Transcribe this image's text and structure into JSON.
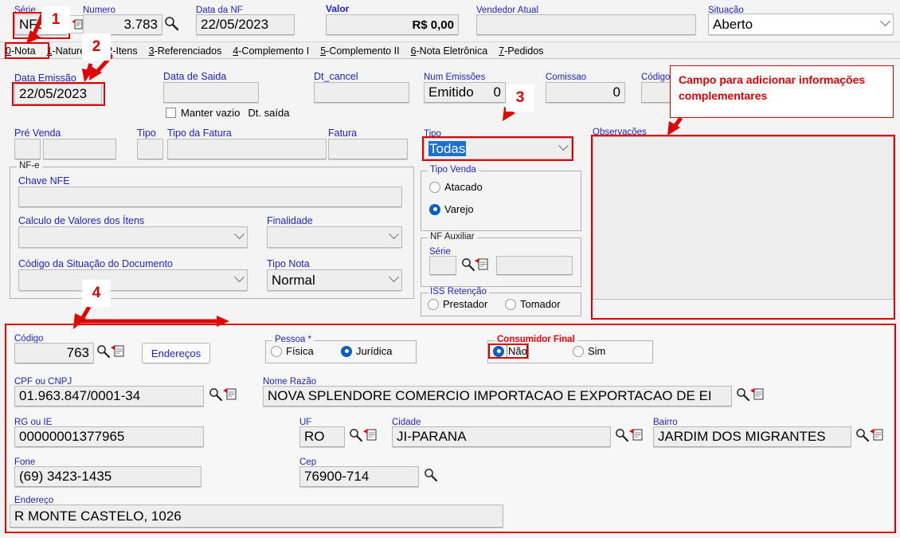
{
  "header": {
    "serie": {
      "label": "Série",
      "value": "NFE"
    },
    "numero": {
      "label": "Numero",
      "value": "3.783"
    },
    "data_nf": {
      "label": "Data da NF",
      "value": "22/05/2023"
    },
    "valor": {
      "label": "Valor",
      "value": "R$ 0,00"
    },
    "vendedor": {
      "label": "Vendedor Atual",
      "value": ""
    },
    "situacao": {
      "label": "Situação",
      "value": "Aberto"
    }
  },
  "tabs": [
    {
      "key": "0",
      "label": "0-Nota",
      "active": true
    },
    {
      "key": "1",
      "label": "1-Natureza",
      "active": false
    },
    {
      "key": "2",
      "label": "2-Itens",
      "active": false
    },
    {
      "key": "3",
      "label": "3-Referenciados",
      "active": false
    },
    {
      "key": "4",
      "label": "4-Complemento I",
      "active": false
    },
    {
      "key": "5",
      "label": "5-Complemento II",
      "active": false
    },
    {
      "key": "6",
      "label": "6-Nota Eletrônica",
      "active": false
    },
    {
      "key": "7",
      "label": "7-Pedidos",
      "active": false
    }
  ],
  "nota": {
    "data_emissao": {
      "label": "Data Emissão",
      "value": "22/05/2023"
    },
    "data_saida": {
      "label": "Data de Saida",
      "value": ""
    },
    "manter_vazio": {
      "label": "Manter vazio",
      "label2": "Dt. saída",
      "checked": false
    },
    "dt_cancel": {
      "label": "Dt_cancel",
      "value": ""
    },
    "num_emissoes": {
      "label": "Num Emissões",
      "value": "Emitido",
      "value2": "0"
    },
    "comissao": {
      "label": "Comissao",
      "value": "0"
    },
    "codigo_top": {
      "label": "Código",
      "value": ""
    },
    "pre_venda": {
      "label": "Pré Venda",
      "value": "",
      "value2": ""
    },
    "tipo_small": {
      "label": "Tipo",
      "value": ""
    },
    "tipo_fatura": {
      "label": "Tipo da Fatura",
      "value": ""
    },
    "fatura": {
      "label": "Fatura",
      "value": ""
    },
    "tipo": {
      "label": "Tipo",
      "value": "Todas"
    },
    "observacoes": {
      "label": "Observações",
      "value": ""
    }
  },
  "nfe": {
    "group_title": "NF-e",
    "chave_nfe": {
      "label": "Chave NFE",
      "value": ""
    },
    "calculo_valores": {
      "label": "Calculo de Valores dos Ítens",
      "value": ""
    },
    "finalidade": {
      "label": "Finalidade",
      "value": ""
    },
    "cod_situacao": {
      "label": "Código da Situação do Documento",
      "value": ""
    },
    "tipo_nota": {
      "label": "Tipo Nota",
      "value": "Normal"
    }
  },
  "tipo_venda": {
    "group_title": "Tipo Venda",
    "options": [
      {
        "label": "Atacado",
        "selected": false
      },
      {
        "label": "Varejo",
        "selected": true
      }
    ]
  },
  "nf_auxiliar": {
    "group_title": "NF Auxiliar",
    "serie": {
      "label": "Série",
      "value": ""
    },
    "numero": {
      "value": ""
    }
  },
  "iss_retencao": {
    "group_title": "ISS Retenção",
    "options": [
      {
        "label": "Prestador",
        "selected": false
      },
      {
        "label": "Tomador",
        "selected": false
      }
    ]
  },
  "cliente": {
    "codigo": {
      "label": "Código",
      "value": "763"
    },
    "enderecos_button": "Endereços",
    "pessoa": {
      "group_title": "Pessoa *",
      "options": [
        {
          "label": "Física",
          "selected": false
        },
        {
          "label": "Jurídica",
          "selected": true
        }
      ]
    },
    "consumidor_final": {
      "group_title": "Consumidor Final",
      "options": [
        {
          "label": "Não",
          "selected": true,
          "focused": true
        },
        {
          "label": "Sim",
          "selected": false
        }
      ]
    },
    "cpf_cnpj": {
      "label": "CPF ou CNPJ",
      "value": "01.963.847/0001-34"
    },
    "nome_razao": {
      "label": "Nome Razão",
      "value": "NOVA SPLENDORE COMERCIO IMPORTACAO E EXPORTACAO DE EI"
    },
    "rg_ie": {
      "label": "RG ou IE",
      "value": "00000001377965"
    },
    "uf": {
      "label": "UF",
      "value": "RO"
    },
    "cidade": {
      "label": "Cidade",
      "value": "JI-PARANA"
    },
    "bairro": {
      "label": "Bairro",
      "value": "JARDIM DOS MIGRANTES"
    },
    "fone": {
      "label": "Fone",
      "value": "(69) 3423-1435"
    },
    "cep": {
      "label": "Cep",
      "value": "76900-714"
    },
    "endereco": {
      "label": "Endereço",
      "value": "R MONTE CASTELO, 1026"
    }
  },
  "annotations": {
    "markers": [
      "1",
      "2",
      "3",
      "4"
    ],
    "callout": "Campo para adicionar informações complementares",
    "color": "#e00000"
  },
  "icons": {
    "magnifier": "search-icon",
    "document": "document-icon",
    "chevron": "chevron-down-icon"
  }
}
